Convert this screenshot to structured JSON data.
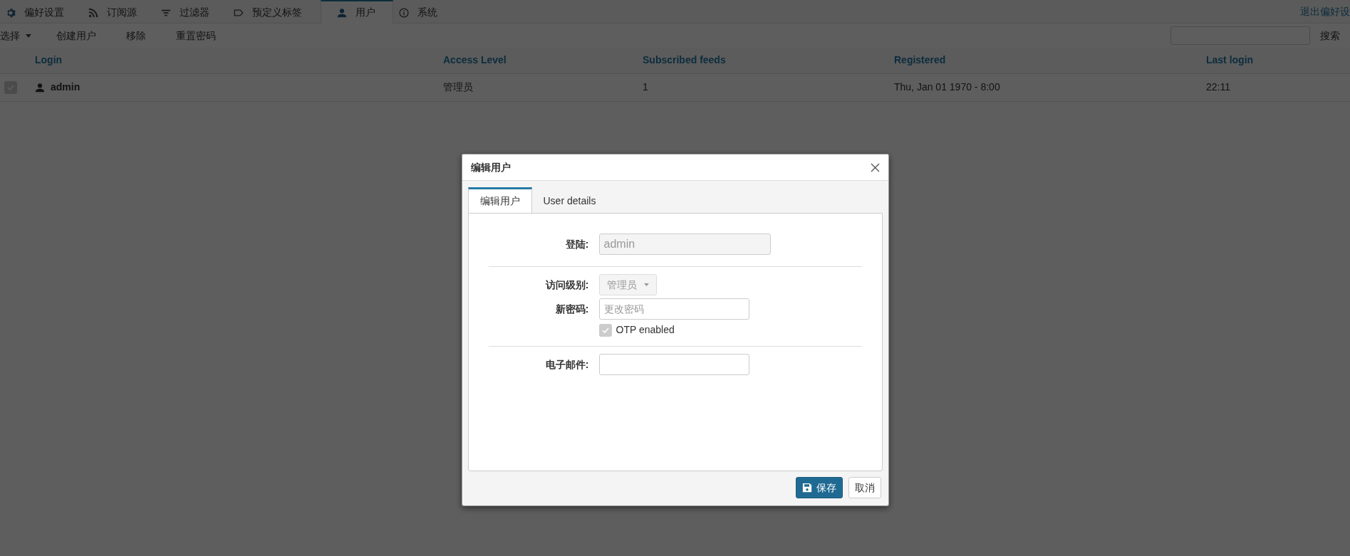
{
  "top_tabs": [
    {
      "label": "偏好设置",
      "selected": false
    },
    {
      "label": "订阅源",
      "selected": false
    },
    {
      "label": "过滤器",
      "selected": false
    },
    {
      "label": "预定义标签",
      "selected": false
    },
    {
      "label": "用户",
      "selected": true
    },
    {
      "label": "系统",
      "selected": false
    }
  ],
  "logout_link": "退出偏好设",
  "toolbar": {
    "select_menu": "选择",
    "buttons": [
      "创建用户",
      "移除",
      "重置密码"
    ],
    "search_button": "搜索"
  },
  "table": {
    "columns": [
      "Login",
      "Access Level",
      "Subscribed feeds",
      "Registered",
      "Last login"
    ],
    "rows": [
      {
        "checked": true,
        "login": "admin",
        "access_level": "管理员",
        "subscribed_feeds": "1",
        "registered": "Thu, Jan 01 1970 - 8:00",
        "last_login": "22:11"
      }
    ]
  },
  "dialog": {
    "title": "编辑用户",
    "tabs": [
      {
        "label": "编辑用户",
        "selected": true
      },
      {
        "label": "User details",
        "selected": false
      }
    ],
    "sections": [
      [
        {
          "kind": "text",
          "label": "登陆:",
          "value": "admin",
          "disabled": true
        }
      ],
      [
        {
          "kind": "select",
          "label": "访问级别:",
          "value": "管理员",
          "disabled": true
        },
        {
          "kind": "password",
          "label": "新密码:",
          "placeholder": "更改密码"
        },
        {
          "kind": "checkbox",
          "text": "OTP enabled",
          "checked": true,
          "disabled": true
        }
      ],
      [
        {
          "kind": "email",
          "label": "电子邮件:"
        }
      ]
    ],
    "buttons": [
      {
        "label": "保存",
        "kind": "primary"
      },
      {
        "label": "取消",
        "kind": "default"
      }
    ]
  }
}
